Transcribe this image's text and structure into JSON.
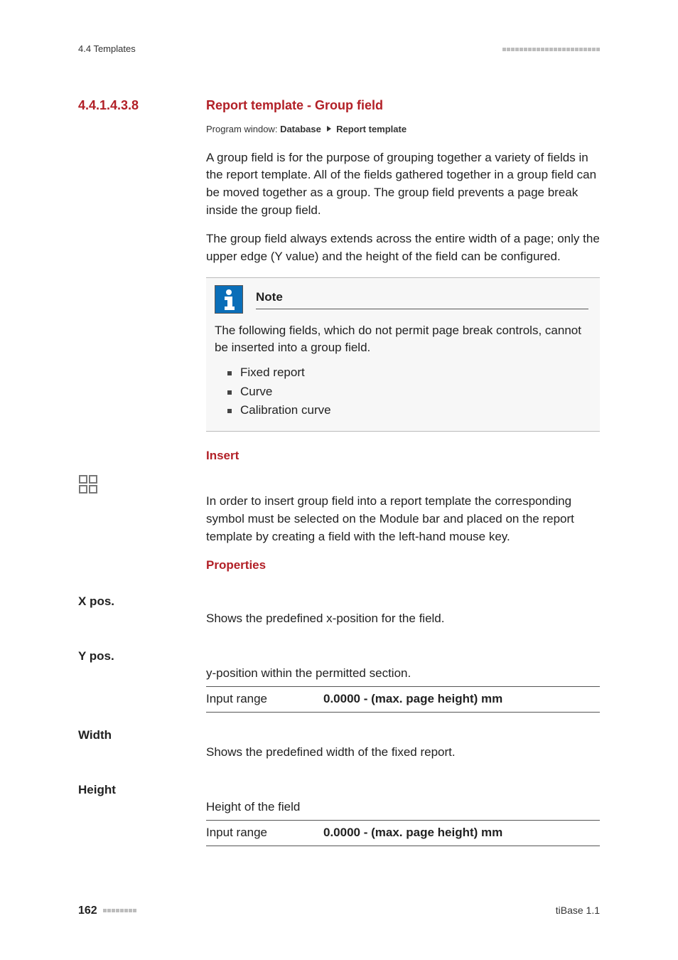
{
  "header": {
    "left": "4.4 Templates"
  },
  "section": {
    "number": "4.4.1.4.3.8",
    "title": "Report template - Group field"
  },
  "programWindow": {
    "label": "Program window:",
    "part1": "Database",
    "part2": "Report template"
  },
  "paragraphs": {
    "p1": "A group field is for the purpose of grouping together a variety of fields in the report template. All of the fields gathered together in a group field can be moved together as a group. The group field prevents a page break inside the group field.",
    "p2": "The group field always extends across the entire width of a page; only the upper edge (Y value) and the height of the field can be configured."
  },
  "note": {
    "title": "Note",
    "text": "The following fields, which do not permit page break controls, cannot be inserted into a group field.",
    "items": [
      "Fixed report",
      "Curve",
      "Calibration curve"
    ]
  },
  "insert": {
    "heading": "Insert",
    "text": "In order to insert group field into a report template the corresponding symbol must be selected on the Module bar and placed on the report template by creating a field with the left-hand mouse key."
  },
  "properties": {
    "heading": "Properties",
    "xpos": {
      "label": "X pos.",
      "text": "Shows the predefined x-position for the field."
    },
    "ypos": {
      "label": "Y pos.",
      "text": "y-position within the permitted section.",
      "rangeLabel": "Input range",
      "rangeValue": "0.0000 - (max. page height) mm"
    },
    "width": {
      "label": "Width",
      "text": "Shows the predefined width of the fixed report."
    },
    "height": {
      "label": "Height",
      "text": "Height of the field",
      "rangeLabel": "Input range",
      "rangeValue": "0.0000 - (max. page height) mm"
    }
  },
  "footer": {
    "pageNumber": "162",
    "right": "tiBase 1.1"
  }
}
